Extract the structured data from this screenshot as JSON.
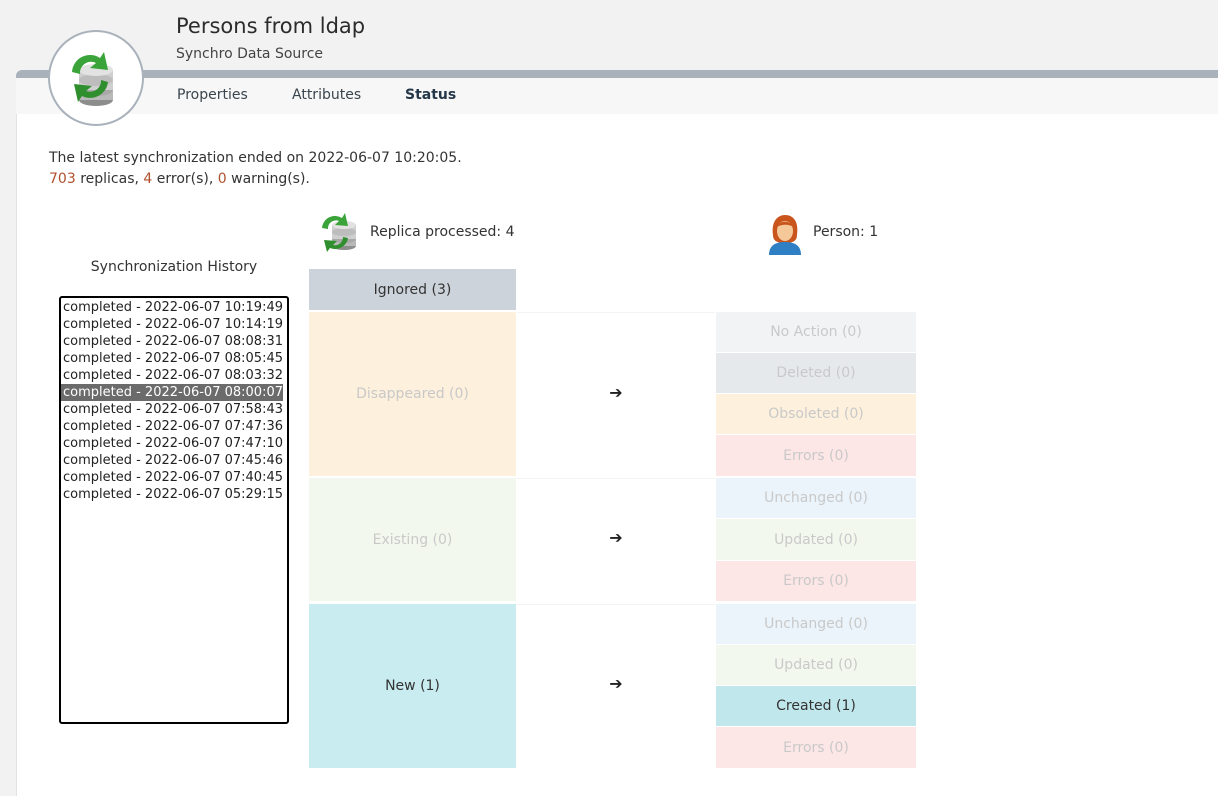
{
  "header": {
    "title": "Persons from ldap",
    "subtitle": "Synchro Data Source",
    "icon": "sync-database-icon"
  },
  "tabs": [
    {
      "label": "Properties",
      "active": false
    },
    {
      "label": "Attributes",
      "active": false
    },
    {
      "label": "Status",
      "active": true
    }
  ],
  "summary": {
    "line1": "The latest synchronization ended on 2022-06-07 10:20:05.",
    "replicas_count": "703",
    "replicas_label": "replicas,",
    "errors_count": "4",
    "errors_label": "error(s),",
    "warnings_count": "0",
    "warnings_label": "warning(s).",
    "highlight_color": "#b0512e"
  },
  "history": {
    "title": "Synchronization History",
    "items": [
      "completed - 2022-06-07 10:19:49",
      "completed - 2022-06-07 10:14:19",
      "completed - 2022-06-07 08:08:31",
      "completed - 2022-06-07 08:05:45",
      "completed - 2022-06-07 08:03:32",
      "completed - 2022-06-07 08:00:07",
      "completed - 2022-06-07 07:58:43",
      "completed - 2022-06-07 07:47:36",
      "completed - 2022-06-07 07:47:10",
      "completed - 2022-06-07 07:45:46",
      "completed - 2022-06-07 07:40:45",
      "completed - 2022-06-07 05:29:15"
    ],
    "selected_index": 5
  },
  "replica": {
    "label": "Replica processed: 4",
    "icon": "sync-database-icon",
    "ignored": "Ignored (3)",
    "disappeared": "Disappeared (0)",
    "existing": "Existing (0)",
    "new": "New (1)"
  },
  "person": {
    "label": "Person: 1",
    "icon": "person-icon",
    "disappeared_results": [
      "No Action (0)",
      "Deleted (0)",
      "Obsoleted (0)",
      "Errors (0)"
    ],
    "existing_results": [
      "Unchanged (0)",
      "Updated (0)",
      "Errors (0)"
    ],
    "new_results": [
      "Unchanged (0)",
      "Updated (0)",
      "Created (1)",
      "Errors (0)"
    ]
  },
  "arrow_glyph": "➔",
  "colors": {
    "ignored": "#cdd3da",
    "disappeared": "#fdf0dc",
    "existing": "#f3f8ee",
    "new": "#c8ecf0",
    "no_action": "#f2f3f4",
    "deleted": "#e6e9ec",
    "obsoleted": "#fdf0dc",
    "errors": "#fde6e6",
    "unchanged": "#ebf4fb",
    "updated": "#f3f8ee",
    "created": "#c0e8ec"
  }
}
